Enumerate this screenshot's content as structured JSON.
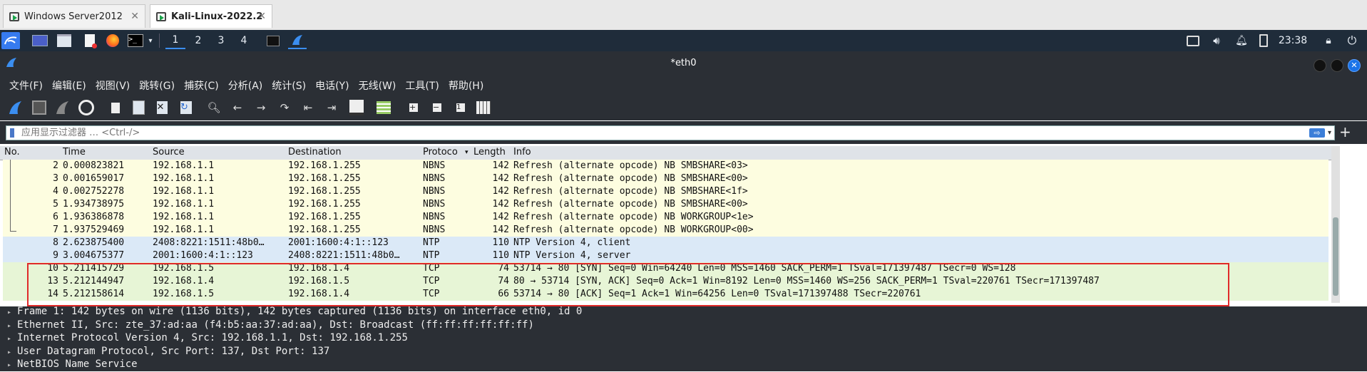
{
  "vm_tabs": [
    {
      "label": "Windows Server2012"
    },
    {
      "label": "Kali-Linux-2022.2"
    }
  ],
  "panel": {
    "workspaces": [
      "1",
      "2",
      "3",
      "4"
    ],
    "clock": "23:38"
  },
  "window": {
    "title": "*eth0"
  },
  "menu": [
    "文件(F)",
    "编辑(E)",
    "视图(V)",
    "跳转(G)",
    "捕获(C)",
    "分析(A)",
    "统计(S)",
    "电话(Y)",
    "无线(W)",
    "工具(T)",
    "帮助(H)"
  ],
  "filter": {
    "placeholder": "应用显示过滤器 … <Ctrl-/>"
  },
  "columns": {
    "no": "No.",
    "time": "Time",
    "source": "Source",
    "destination": "Destination",
    "protocol": "Protoco",
    "length": "Length",
    "info": "Info"
  },
  "packets": [
    {
      "no": "2",
      "time": "0.000823821",
      "source": "192.168.1.1",
      "destination": "192.168.1.255",
      "protocol": "NBNS",
      "length": "142",
      "info": "Refresh (alternate opcode) NB SMBSHARE<03>",
      "color": "#fdfde0"
    },
    {
      "no": "3",
      "time": "0.001659017",
      "source": "192.168.1.1",
      "destination": "192.168.1.255",
      "protocol": "NBNS",
      "length": "142",
      "info": "Refresh (alternate opcode) NB SMBSHARE<00>",
      "color": "#fdfde0"
    },
    {
      "no": "4",
      "time": "0.002752278",
      "source": "192.168.1.1",
      "destination": "192.168.1.255",
      "protocol": "NBNS",
      "length": "142",
      "info": "Refresh (alternate opcode) NB SMBSHARE<1f>",
      "color": "#fdfde0"
    },
    {
      "no": "5",
      "time": "1.934738975",
      "source": "192.168.1.1",
      "destination": "192.168.1.255",
      "protocol": "NBNS",
      "length": "142",
      "info": "Refresh (alternate opcode) NB SMBSHARE<00>",
      "color": "#fdfde0"
    },
    {
      "no": "6",
      "time": "1.936386878",
      "source": "192.168.1.1",
      "destination": "192.168.1.255",
      "protocol": "NBNS",
      "length": "142",
      "info": "Refresh (alternate opcode) NB WORKGROUP<1e>",
      "color": "#fdfde0"
    },
    {
      "no": "7",
      "time": "1.937529469",
      "source": "192.168.1.1",
      "destination": "192.168.1.255",
      "protocol": "NBNS",
      "length": "142",
      "info": "Refresh (alternate opcode) NB WORKGROUP<00>",
      "color": "#fdfde0"
    },
    {
      "no": "8",
      "time": "2.623875400",
      "source": "2408:8221:1511:48b0…",
      "destination": "2001:1600:4:1::123",
      "protocol": "NTP",
      "length": "110",
      "info": "NTP Version 4, client",
      "color": "#dbe9f7"
    },
    {
      "no": "9",
      "time": "3.004675377",
      "source": "2001:1600:4:1::123",
      "destination": "2408:8221:1511:48b0…",
      "protocol": "NTP",
      "length": "110",
      "info": "NTP Version 4, server",
      "color": "#dbe9f7"
    },
    {
      "no": "10",
      "time": "5.211415729",
      "source": "192.168.1.5",
      "destination": "192.168.1.4",
      "protocol": "TCP",
      "length": "74",
      "info": "53714 → 80 [SYN] Seq=0 Win=64240 Len=0 MSS=1460 SACK_PERM=1 TSval=171397487 TSecr=0 WS=128",
      "color": "#e7f5d6"
    },
    {
      "no": "13",
      "time": "5.212144947",
      "source": "192.168.1.4",
      "destination": "192.168.1.5",
      "protocol": "TCP",
      "length": "74",
      "info": "80 → 53714 [SYN, ACK] Seq=0 Ack=1 Win=8192 Len=0 MSS=1460 WS=256 SACK_PERM=1 TSval=220761 TSecr=171397487",
      "color": "#e7f5d6"
    },
    {
      "no": "14",
      "time": "5.212158614",
      "source": "192.168.1.5",
      "destination": "192.168.1.4",
      "protocol": "TCP",
      "length": "66",
      "info": "53714 → 80 [ACK] Seq=1 Ack=1 Win=64256 Len=0 TSval=171397488 TSecr=220761",
      "color": "#e7f5d6"
    }
  ],
  "details": [
    "Frame 1: 142 bytes on wire (1136 bits), 142 bytes captured (1136 bits) on interface eth0, id 0",
    "Ethernet II, Src: zte_37:ad:aa (f4:b5:aa:37:ad:aa), Dst: Broadcast (ff:ff:ff:ff:ff:ff)",
    "Internet Protocol Version 4, Src: 192.168.1.1, Dst: 192.168.1.255",
    "User Datagram Protocol, Src Port: 137, Dst Port: 137",
    "NetBIOS Name Service"
  ]
}
